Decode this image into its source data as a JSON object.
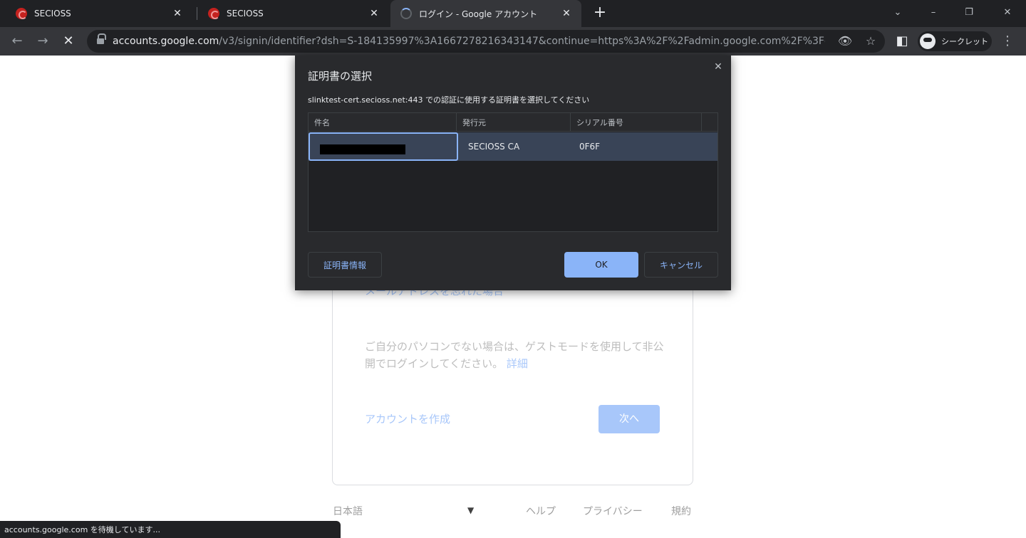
{
  "browser": {
    "tabs": [
      {
        "title": "SECIOSS",
        "close": "✕"
      },
      {
        "title": "SECIOSS",
        "close": "✕"
      },
      {
        "title": "ログイン - Google アカウント",
        "close": "✕"
      }
    ],
    "new_tab": "+",
    "window_controls": {
      "tab_search": "⌄",
      "minimize": "–",
      "restore": "❐",
      "close": "✕"
    },
    "toolbar": {
      "back": "←",
      "forward": "→",
      "stop": "✕"
    },
    "url_host": "accounts.google.com",
    "url_path": "/v3/signin/identifier?dsh=S-184135997%3A1667278216343147&continue=https%3A%2F%2Fadmin.google.com%2F%3Fd...",
    "omnibox_icons": {
      "tracking": "👁",
      "bookmark": "☆"
    },
    "side_panel": "◧",
    "profile_label": "シークレット",
    "menu": "⋮",
    "status_text": "accounts.google.com を待機しています..."
  },
  "page": {
    "forgot_email": "メールアドレスを忘れた場合",
    "guest_text": "ご自分のパソコンでない場合は、ゲストモードを使用して非公開でログインしてください。",
    "guest_link": "詳細",
    "create_account": "アカウントを作成",
    "next": "次へ",
    "footer": {
      "language": "日本語",
      "caret": "▼",
      "help": "ヘルプ",
      "privacy": "プライバシー",
      "terms": "規約"
    }
  },
  "dialog": {
    "title": "証明書の選択",
    "close": "✕",
    "description": "slinktest-cert.secioss.net:443 での認証に使用する証明書を選択してください",
    "columns": [
      "件名",
      "発行元",
      "シリアル番号"
    ],
    "rows": [
      {
        "subject": "",
        "issuer": "SECIOSS CA",
        "serial": "0F6F"
      }
    ],
    "buttons": {
      "info": "証明書情報",
      "ok": "OK",
      "cancel": "キャンセル"
    }
  },
  "colors": {
    "accent": "#8ab4f8",
    "dialog_bg": "#292a2d",
    "selected_row": "#394457",
    "chrome_dark": "#202124"
  }
}
